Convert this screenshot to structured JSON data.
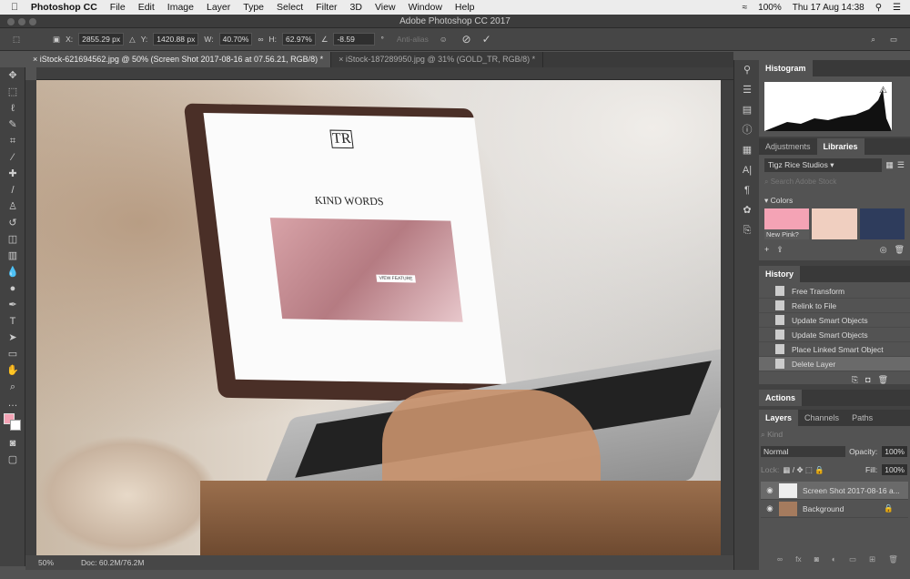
{
  "menubar": {
    "app": "Photoshop CC",
    "items": [
      "File",
      "Edit",
      "Image",
      "Layer",
      "Type",
      "Select",
      "Filter",
      "3D",
      "View",
      "Window",
      "Help"
    ],
    "battery": "100%",
    "clock": "Thu 17 Aug  14:38"
  },
  "window_title": "Adobe Photoshop CC 2017",
  "options": {
    "x_label": "X:",
    "x": "2855.29 px",
    "y_label": "Y:",
    "y": "1420.88 px",
    "w_label": "W:",
    "w": "40.70%",
    "h_label": "H:",
    "h": "62.97%",
    "angle": "-8.59",
    "angle_unit": "°",
    "antialias": "Anti-alias"
  },
  "tabs": [
    {
      "label": "iStock-621694562.jpg @ 50% (Screen Shot 2017-08-16 at 07.56.21, RGB/8) *",
      "active": true
    },
    {
      "label": "iStock-187289950.jpg @ 31% (GOLD_TR, RGB/8) *",
      "active": false
    }
  ],
  "status": {
    "zoom": "50%",
    "doc": "Doc: 60.2M/76.2M"
  },
  "histogram": {
    "title": "Histogram"
  },
  "libraries": {
    "tabs": [
      "Adjustments",
      "Libraries"
    ],
    "library": "Tigz Rice Studios",
    "search_placeholder": "Search Adobe Stock",
    "section": "Colors",
    "swatches": [
      {
        "color": "#f4a3b5",
        "label": "New Pink?"
      },
      {
        "color": "#f0cfc0",
        "label": ""
      },
      {
        "color": "#2e3c5c",
        "label": ""
      }
    ]
  },
  "history": {
    "title": "History",
    "items": [
      "Free Transform",
      "Relink to File",
      "Update Smart Objects",
      "Update Smart Objects",
      "Place Linked Smart Object",
      "Delete Layer"
    ],
    "selected": 5
  },
  "actions": {
    "title": "Actions"
  },
  "layers": {
    "tabs": [
      "Layers",
      "Channels",
      "Paths"
    ],
    "kind": "Kind",
    "blend": "Normal",
    "opacity_label": "Opacity:",
    "opacity": "100%",
    "lock_label": "Lock:",
    "fill_label": "Fill:",
    "fill": "100%",
    "items": [
      {
        "name": "Screen Shot 2017-08-16 a...",
        "selected": true
      },
      {
        "name": "Background",
        "selected": false
      }
    ]
  },
  "canvas": {
    "site_heading": "KIND WORDS",
    "logo": "TR",
    "button": "VIEW FEATURE"
  }
}
